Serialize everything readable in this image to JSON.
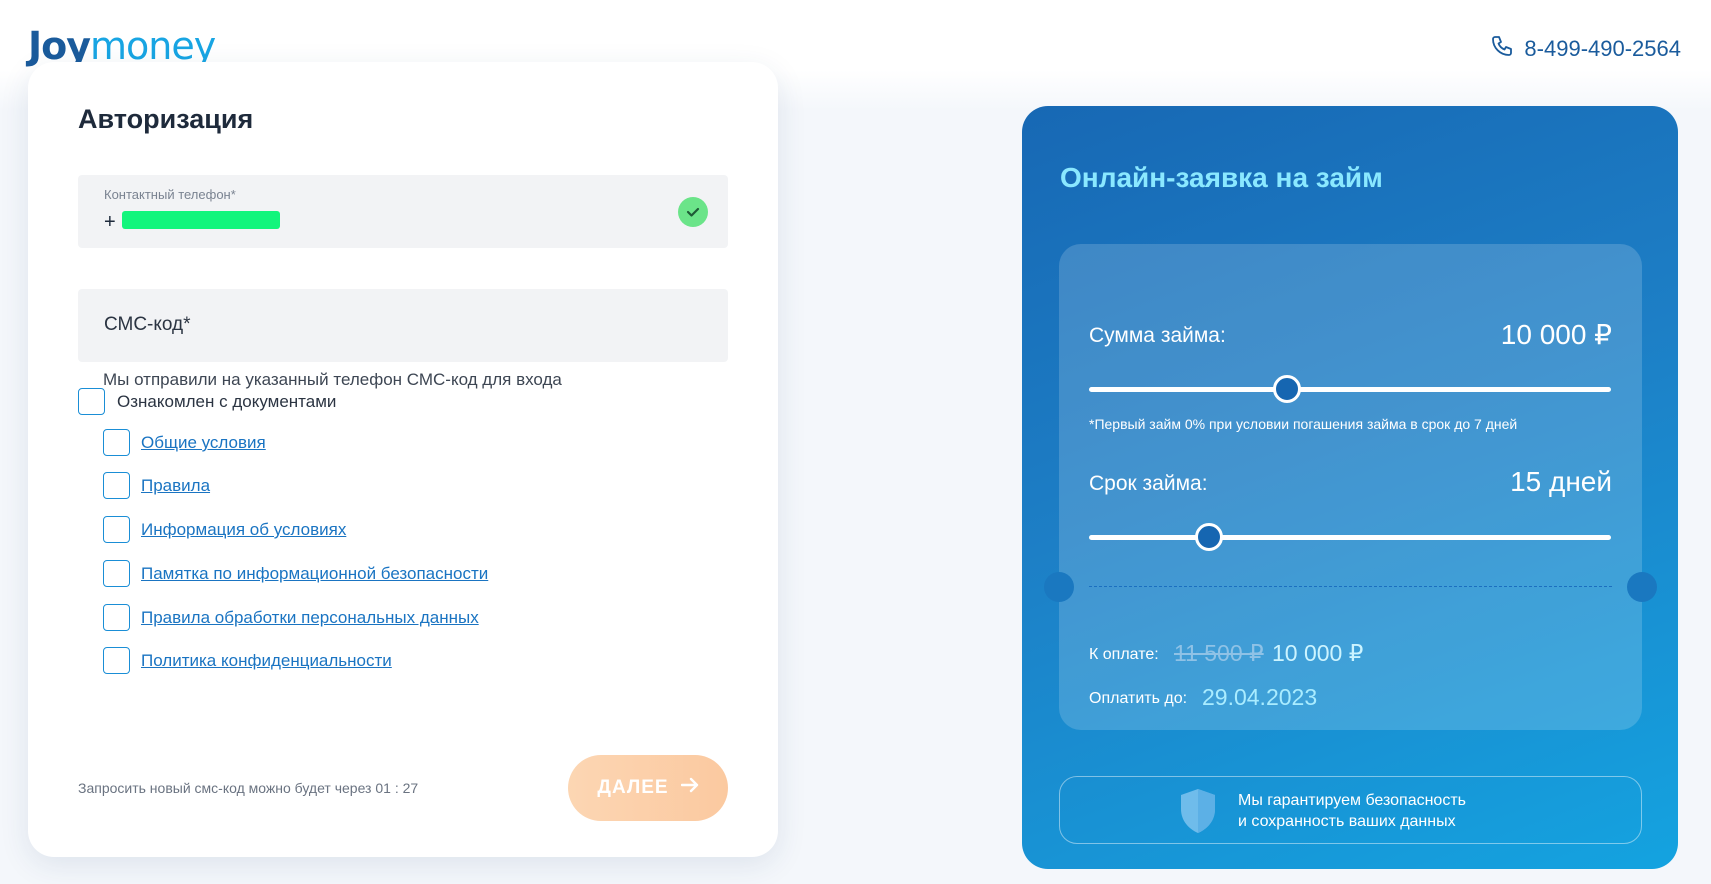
{
  "header": {
    "logo_part1": "Joy",
    "logo_part2": "money",
    "phone": "8-499-490-2564"
  },
  "auth": {
    "title": "Авторизация",
    "phone_label": "Контактный телефон*",
    "phone_value": "+",
    "sms_placeholder": "СМС-код*",
    "sms_hint": "Мы отправили на указанный телефон СМС-код для входа",
    "agree_all_label": "Ознакомлен с документами",
    "documents": [
      "Общие условия",
      "Правила",
      "Информация об условиях",
      "Памятка по информационной безопасности",
      "Правила обработки персональных данных",
      "Политика конфиденциальности"
    ],
    "resend_text": "Запросить новый смс-код можно будет через 01 : 27",
    "next_button": "ДАЛЕЕ"
  },
  "loan": {
    "title": "Онлайн-заявка на займ",
    "amount_label": "Сумма займа:",
    "amount_value": "10 000 ₽",
    "amount_slider_fraction": 0.38,
    "note": "*Первый займ 0% при условии погашения займа в срок до 7 дней",
    "term_label": "Срок займа:",
    "term_value": "15 дней",
    "term_slider_fraction": 0.23,
    "pay_label": "К оплате:",
    "old_price": "11 500 ₽",
    "new_price": "10 000 ₽",
    "due_label": "Оплатить до:",
    "due_date": "29.04.2023",
    "guarantee_line1": "Мы гарантируем безопасность",
    "guarantee_line2": "и сохранность ваших данных"
  },
  "colors": {
    "brand_dark": "#1a5b9c",
    "brand_light": "#18a5e3",
    "accent_orange": "#fbc9a0",
    "success": "#6be489"
  },
  "icons": [
    "phone-icon",
    "check-icon",
    "arrow-right-icon",
    "shield-icon"
  ]
}
